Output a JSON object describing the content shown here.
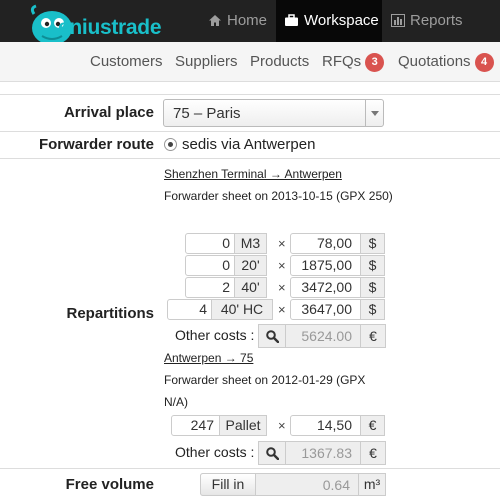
{
  "brand": {
    "name": "eniustrade"
  },
  "nav": {
    "home": "Home",
    "workspace": "Workspace",
    "reports": "Reports"
  },
  "subnav": {
    "customers": "Customers",
    "suppliers": "Suppliers",
    "products": "Products",
    "rfqs": "RFQs",
    "rfqs_badge": "3",
    "quotations": "Quotations",
    "quotations_badge": "4"
  },
  "form": {
    "arrival_label": "Arrival place",
    "arrival_value": "75 – Paris",
    "forwarder_label": "Forwarder route",
    "forwarder_value": "sedis via Antwerpen",
    "repartitions_label": "Repartitions",
    "free_volume_label": "Free volume",
    "fill_in": "Fill in",
    "free_volume_value": "0.64",
    "free_volume_unit": "m³"
  },
  "legs": [
    {
      "route": "Shenzhen Terminal → Antwerpen",
      "sheet": "Forwarder sheet on 2013-10-15 (GPX 250)",
      "rows": [
        {
          "qty": "0",
          "unit": "M3",
          "price": "78,00",
          "currency": "$"
        },
        {
          "qty": "0",
          "unit": "20'",
          "price": "1875,00",
          "currency": "$"
        },
        {
          "qty": "2",
          "unit": "40'",
          "price": "3472,00",
          "currency": "$"
        },
        {
          "qty": "4",
          "unit": "40' HC",
          "price": "3647,00",
          "currency": "$"
        }
      ],
      "other_costs_label": "Other costs :",
      "other_costs": "5624.00",
      "other_costs_currency": "€"
    },
    {
      "route": "Antwerpen → 75",
      "sheet_line1": "Forwarder sheet on 2012-01-29 (GPX",
      "sheet_line2": "N/A)",
      "rows": [
        {
          "qty": "247",
          "unit": "Pallet",
          "price": "14,50",
          "currency": "€"
        }
      ],
      "other_costs_label": "Other costs :",
      "other_costs": "1367.83",
      "other_costs_currency": "€"
    }
  ],
  "times_symbol": "×"
}
